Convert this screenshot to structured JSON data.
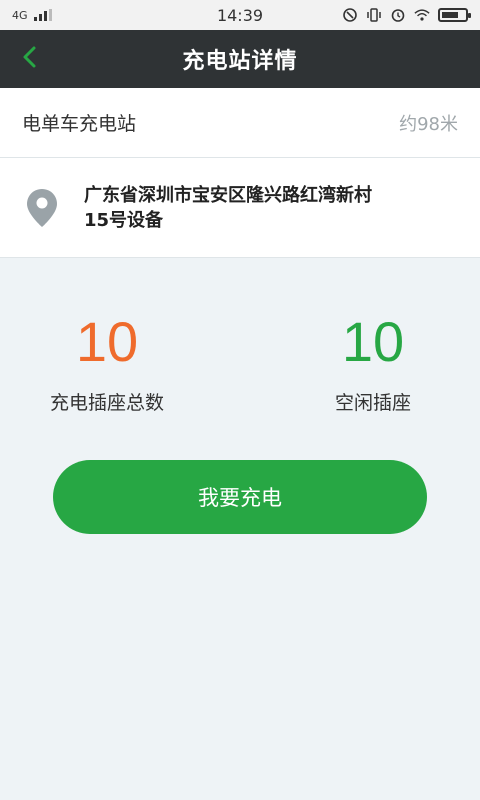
{
  "status_bar": {
    "network": "4G",
    "time": "14:39",
    "icons": [
      "signal-icon",
      "nfc-icon",
      "vibrate-icon",
      "alarm-icon",
      "wifi-icon",
      "battery-icon"
    ]
  },
  "header": {
    "title": "充电站详情",
    "back_icon": "chevron-left-icon"
  },
  "station": {
    "name": "电单车充电站",
    "distance": "约98米",
    "address": "广东省深圳市宝安区隆兴路红湾新村15号设备",
    "address_icon": "location-pin-icon"
  },
  "stats": {
    "total_count": "10",
    "total_label": "充电插座总数",
    "free_count": "10",
    "free_label": "空闲插座"
  },
  "action": {
    "charge_label": "我要充电"
  },
  "colors": {
    "header_bg": "#2f3335",
    "accent_green": "#27a744",
    "accent_orange": "#ef6b2c",
    "page_bg": "#eef3f6"
  }
}
